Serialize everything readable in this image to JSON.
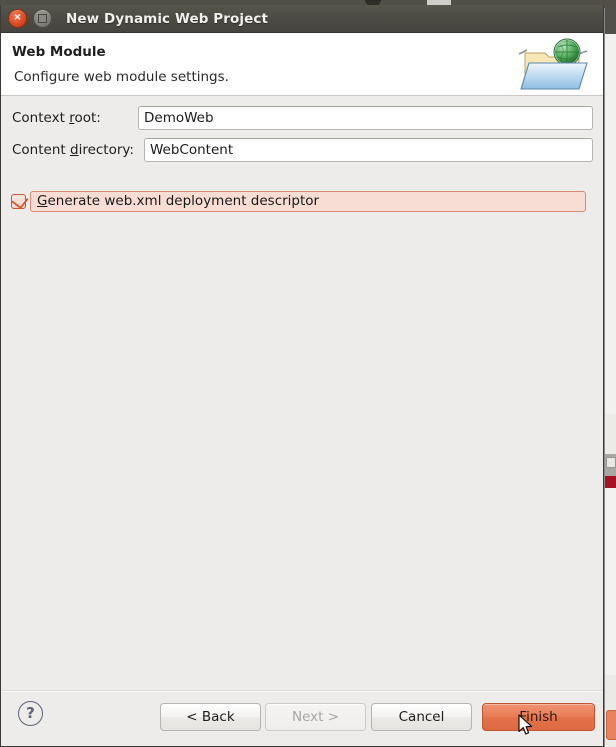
{
  "window": {
    "title": "New Dynamic Web Project",
    "close_icon": "close-icon",
    "maximize_icon": "maximize-icon",
    "close_glyph": "×"
  },
  "header": {
    "title": "Web Module",
    "subtitle": "Configure web module settings.",
    "icon": "web-project-folder-globe-icon"
  },
  "form": {
    "context_root": {
      "label_pre": "Context ",
      "label_mnemonic": "r",
      "label_post": "oot:",
      "value": "DemoWeb",
      "placeholder": ""
    },
    "content_directory": {
      "label_pre": "Content ",
      "label_mnemonic": "d",
      "label_post": "irectory:",
      "value": "WebContent",
      "placeholder": ""
    },
    "generate_webxml": {
      "label_mnemonic": "G",
      "label_post": "enerate web.xml deployment descriptor",
      "checked": true
    }
  },
  "footer": {
    "help_glyph": "?",
    "buttons": {
      "back": "< Back",
      "next": "Next >",
      "cancel": "Cancel",
      "finish": "Finish"
    }
  },
  "colors": {
    "titlebar": "#4b4a42",
    "dialog_bg": "#edecea",
    "header_bg": "#ffffff",
    "accent_orange": "#e4724a",
    "highlight_pink": "#f8ddd5",
    "highlight_border": "#d98a72",
    "checkbox_border": "#c2573a",
    "disabled_text": "#a8a6a2"
  }
}
